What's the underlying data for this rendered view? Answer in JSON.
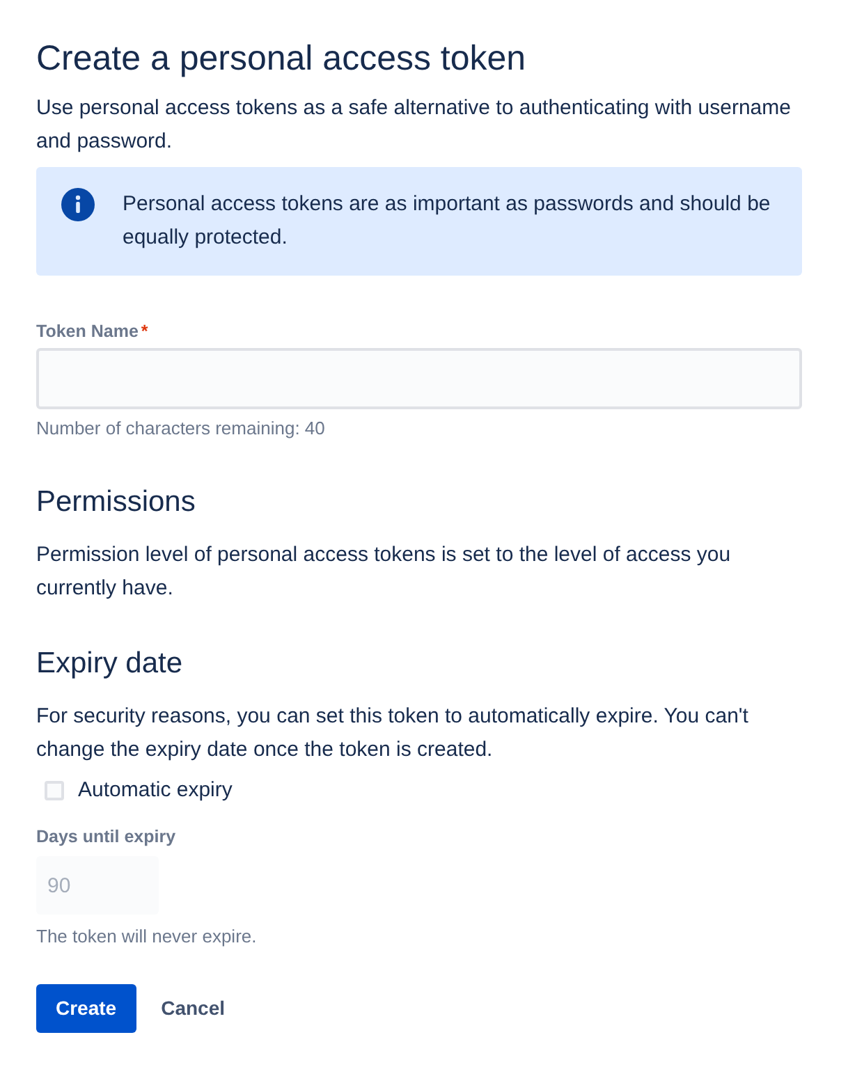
{
  "page": {
    "title": "Create a personal access token",
    "description": "Use personal access tokens as a safe alternative to authenticating with username and password."
  },
  "info_message": {
    "text": "Personal access tokens are as important as passwords and should be equally protected."
  },
  "token_name": {
    "label": "Token Name",
    "required_mark": "*",
    "helper": "Number of characters remaining: 40"
  },
  "permissions": {
    "heading": "Permissions",
    "text": "Permission level of personal access tokens is set to the level of access you currently have."
  },
  "expiry": {
    "heading": "Expiry date",
    "text": "For security reasons, you can set this token to automatically expire. You can't change the expiry date once the token is created.",
    "checkbox": {
      "label": "Automatic expiry",
      "checked": false
    },
    "days_field": {
      "label": "Days until expiry",
      "value": "90",
      "disabled": true
    },
    "helper": "The token will never expire."
  },
  "buttons": [
    {
      "label": "Create",
      "kind": "primary"
    },
    {
      "label": "Cancel",
      "kind": "subtle"
    }
  ]
}
